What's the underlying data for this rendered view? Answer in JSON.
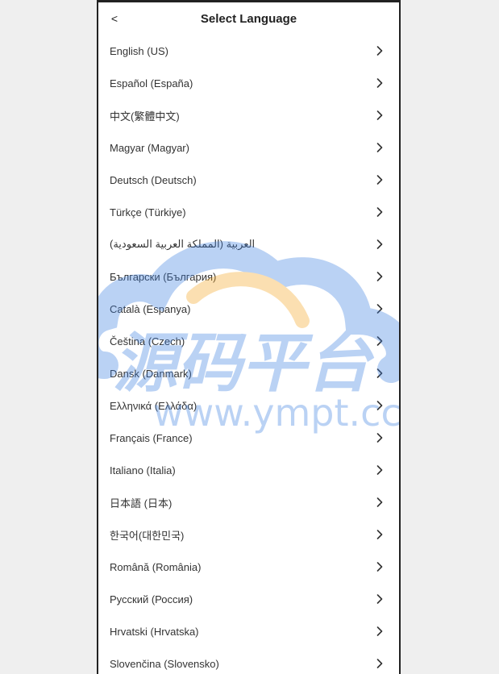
{
  "header": {
    "back_label": "<",
    "title": "Select Language"
  },
  "languages": [
    {
      "label": "English (US)"
    },
    {
      "label": "Español (España)"
    },
    {
      "label": "中文(繁體中文)"
    },
    {
      "label": "Magyar (Magyar)"
    },
    {
      "label": "Deutsch (Deutsch)"
    },
    {
      "label": "Türkçe (Türkiye)"
    },
    {
      "label": "العربية (المملكة العربية السعودية)"
    },
    {
      "label": "Български (България)"
    },
    {
      "label": "Català (Espanya)"
    },
    {
      "label": "Čeština (Czech)"
    },
    {
      "label": "Dansk (Danmark)"
    },
    {
      "label": "Ελληνικά (Ελλάδα)"
    },
    {
      "label": "Français (France)"
    },
    {
      "label": "Italiano (Italia)"
    },
    {
      "label": "日本語 (日本)"
    },
    {
      "label": "한국어(대한민국)"
    },
    {
      "label": "Română (România)"
    },
    {
      "label": "Русский (Россия)"
    },
    {
      "label": "Hrvatski (Hrvatska)"
    },
    {
      "label": "Slovenčina (Slovensko)"
    }
  ],
  "watermark": {
    "text_cn": "源码平台",
    "text_url": "www.ympt.cc"
  },
  "colors": {
    "watermark_blue": "#3d7fe0",
    "watermark_orange": "#f5a623"
  }
}
